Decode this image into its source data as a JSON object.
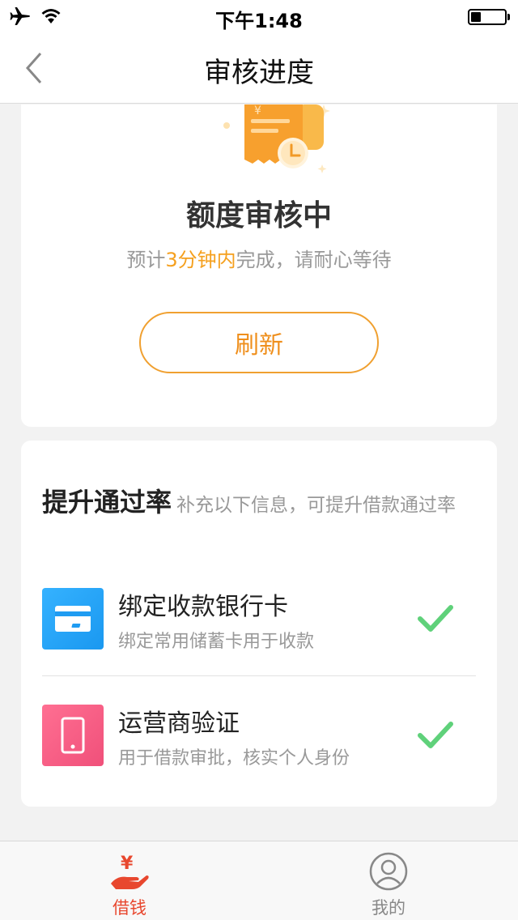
{
  "status_bar": {
    "time": "下午1:48"
  },
  "nav": {
    "title": "审核进度",
    "back_icon": "chevron-left-icon"
  },
  "status_card": {
    "title": "额度审核中",
    "subtitle_prefix": "预计",
    "subtitle_highlight": "3分钟内",
    "subtitle_suffix": "完成，请耐心等待",
    "refresh_label": "刷新",
    "highlight_color": "#f5a01e"
  },
  "improve": {
    "heading": "提升通过率",
    "description": "补充以下信息，可提升借款通过率",
    "items": [
      {
        "name": "绑定收款银行卡",
        "desc": "绑定常用储蓄卡用于收款",
        "icon": "bank-card-icon",
        "completed": true
      },
      {
        "name": "运营商验证",
        "desc": "用于借款审批，核实个人身份",
        "icon": "phone-icon",
        "completed": true
      }
    ]
  },
  "tabs": [
    {
      "label": "借钱",
      "icon": "hand-yuan-icon",
      "active": true
    },
    {
      "label": "我的",
      "icon": "user-icon",
      "active": false
    }
  ],
  "colors": {
    "accent": "#ef8f1c",
    "tab_active": "#e8472e",
    "check": "#5fd17a"
  }
}
